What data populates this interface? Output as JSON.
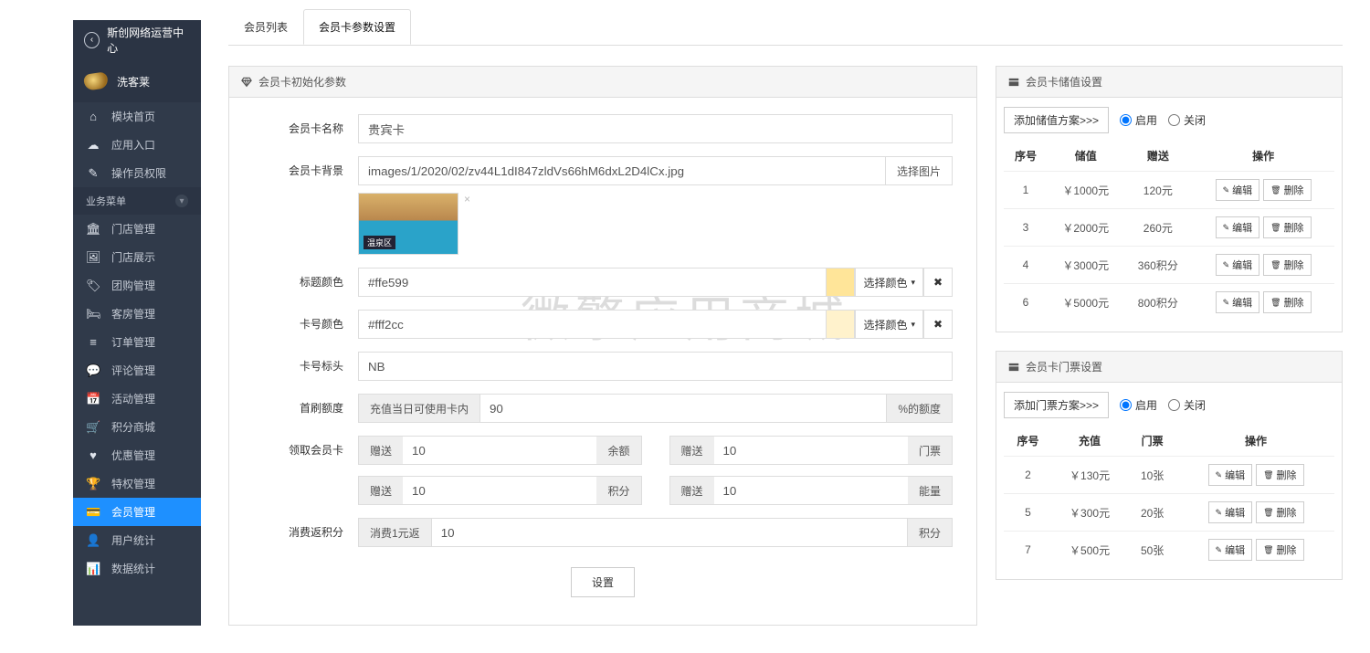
{
  "watermark": "微擎应用商城",
  "sidebar": {
    "title": "斯创网络运营中心",
    "brand": "洗客莱",
    "topItems": [
      {
        "icon": "home",
        "label": "模块首页"
      },
      {
        "icon": "entry",
        "label": "应用入口"
      },
      {
        "icon": "perm",
        "label": "操作员权限"
      }
    ],
    "groupLabel": "业务菜单",
    "bizItems": [
      {
        "icon": "store",
        "label": "门店管理"
      },
      {
        "icon": "show",
        "label": "门店展示"
      },
      {
        "icon": "group",
        "label": "团购管理"
      },
      {
        "icon": "room",
        "label": "客房管理"
      },
      {
        "icon": "order",
        "label": "订单管理"
      },
      {
        "icon": "comment",
        "label": "评论管理"
      },
      {
        "icon": "event",
        "label": "活动管理"
      },
      {
        "icon": "shop",
        "label": "积分商城"
      },
      {
        "icon": "coupon",
        "label": "优惠管理"
      },
      {
        "icon": "priv",
        "label": "特权管理"
      },
      {
        "icon": "member",
        "label": "会员管理",
        "active": true
      },
      {
        "icon": "user",
        "label": "用户统计"
      },
      {
        "icon": "chart",
        "label": "数据统计"
      }
    ]
  },
  "tabs": [
    {
      "label": "会员列表",
      "active": false
    },
    {
      "label": "会员卡参数设置",
      "active": true
    }
  ],
  "initPanel": {
    "title": "会员卡初始化参数",
    "cardNameLabel": "会员卡名称",
    "cardName": "贵宾卡",
    "bgLabel": "会员卡背景",
    "bgPath": "images/1/2020/02/zv44L1dI847zldVs66hM6dxL2D4lCx.jpg",
    "chooseImage": "选择图片",
    "titleColorLabel": "标题颜色",
    "titleColor": "#ffe599",
    "numberColorLabel": "卡号颜色",
    "numberColor": "#fff2cc",
    "pickColor": "选择颜色",
    "prefixLabel": "卡号标头",
    "prefix": "NB",
    "firstLimitLabel": "首刷额度",
    "firstLimitPre": "充值当日可使用卡内",
    "firstLimitVal": "90",
    "firstLimitSuf": "%的额度",
    "receiveLabel": "领取会员卡",
    "gift": "赠送",
    "unitBalance": "余额",
    "unitTicket": "门票",
    "unitPoint": "积分",
    "unitEnergy": "能量",
    "vBalance": "10",
    "vTicket": "10",
    "vPoint": "10",
    "vEnergy": "10",
    "returnLabel": "消费返积分",
    "returnPre": "消费1元返",
    "returnVal": "10",
    "returnSuf": "积分",
    "submit": "设置"
  },
  "rechargePanel": {
    "title": "会员卡储值设置",
    "add": "添加储值方案>>>",
    "enable": "启用",
    "disable": "关闭",
    "enabled": true,
    "cols": {
      "seq": "序号",
      "recharge": "储值",
      "gift": "赠送",
      "op": "操作"
    },
    "edit": "编辑",
    "del": "删除",
    "rows": [
      {
        "seq": "1",
        "recharge": "￥1000元",
        "gift": "120元"
      },
      {
        "seq": "3",
        "recharge": "￥2000元",
        "gift": "260元"
      },
      {
        "seq": "4",
        "recharge": "￥3000元",
        "gift": "360积分"
      },
      {
        "seq": "6",
        "recharge": "￥5000元",
        "gift": "800积分"
      }
    ]
  },
  "ticketPanel": {
    "title": "会员卡门票设置",
    "add": "添加门票方案>>>",
    "enable": "启用",
    "disable": "关闭",
    "enabled": true,
    "cols": {
      "seq": "序号",
      "recharge": "充值",
      "ticket": "门票",
      "op": "操作"
    },
    "edit": "编辑",
    "del": "删除",
    "rows": [
      {
        "seq": "2",
        "recharge": "￥130元",
        "ticket": "10张"
      },
      {
        "seq": "5",
        "recharge": "￥300元",
        "ticket": "20张"
      },
      {
        "seq": "7",
        "recharge": "￥500元",
        "ticket": "50张"
      }
    ]
  }
}
